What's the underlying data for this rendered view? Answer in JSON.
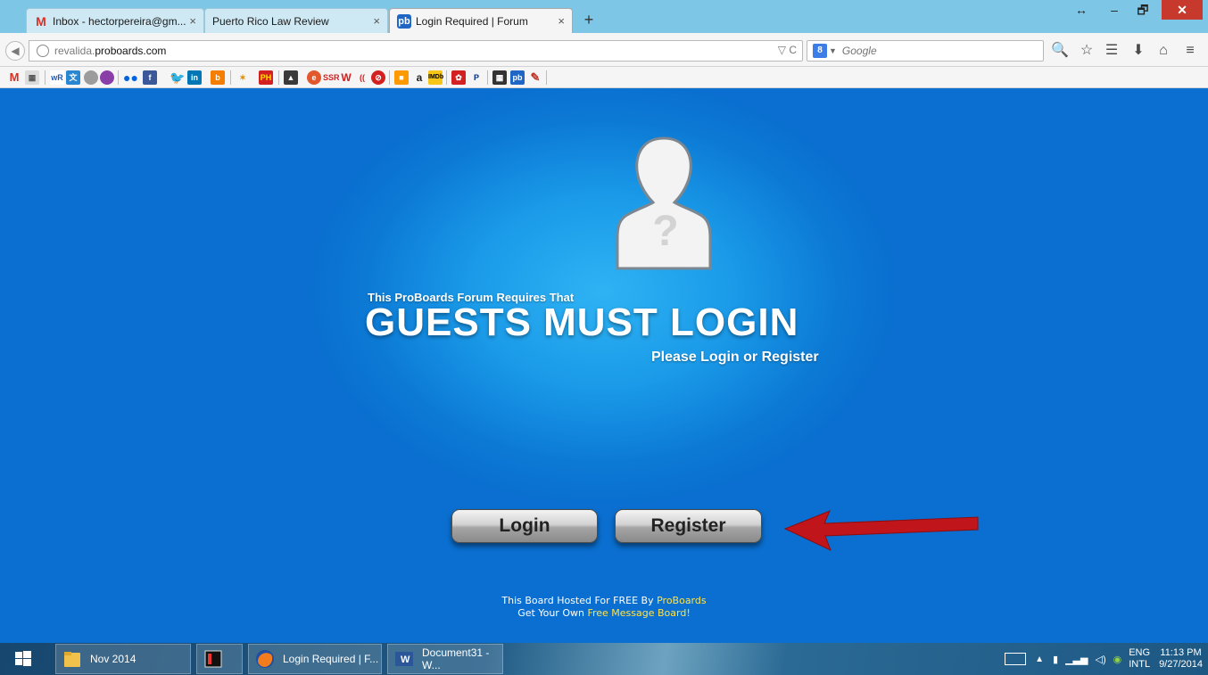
{
  "browser": {
    "tabs": [
      {
        "title": "Inbox - hectorpereira@gm...",
        "close": "×",
        "active": false
      },
      {
        "title": "Puerto Rico Law Review",
        "close": "×",
        "active": false
      },
      {
        "title": "Login Required | Forum",
        "close": "×",
        "active": true
      }
    ],
    "new_tab": "+",
    "window_controls": {
      "resize": "↔",
      "minimize": "–",
      "restore": "🗗",
      "close": "✕"
    },
    "url": {
      "prefix": "revalida.",
      "domain": "proboards.com"
    },
    "url_buttons": "▽ C",
    "search": {
      "engine_badge": "8",
      "placeholder": "Google"
    },
    "nav_icons": {
      "back": "◀",
      "search": "🔍",
      "bookmark": "☆",
      "reading": "☰",
      "download": "⬇",
      "home": "⌂",
      "menu": "≡"
    }
  },
  "page": {
    "heading_pre": "This ProBoards Forum Requires That",
    "heading": "GUESTS MUST LOGIN",
    "heading_sub": "Please Login or Register",
    "avatar_glyph": "?",
    "login_label": "Login",
    "register_label": "Register",
    "footer_line1_pre": "This Board Hosted For FREE By ",
    "footer_line1_link": "ProBoards",
    "footer_line2_pre": "Get Your Own ",
    "footer_line2_link": "Free Message Board!",
    "accent_color": "#0a6fd0",
    "link_color": "#ffe34d",
    "arrow_color": "#c0151a"
  },
  "taskbar": {
    "items": [
      {
        "label": "Nov 2014"
      },
      {
        "label": ""
      },
      {
        "label": "Login Required | F..."
      },
      {
        "label": "Document31 - W..."
      }
    ],
    "language": "ENG",
    "layout": "INTL",
    "time": "11:13 PM",
    "date": "9/27/2014"
  }
}
